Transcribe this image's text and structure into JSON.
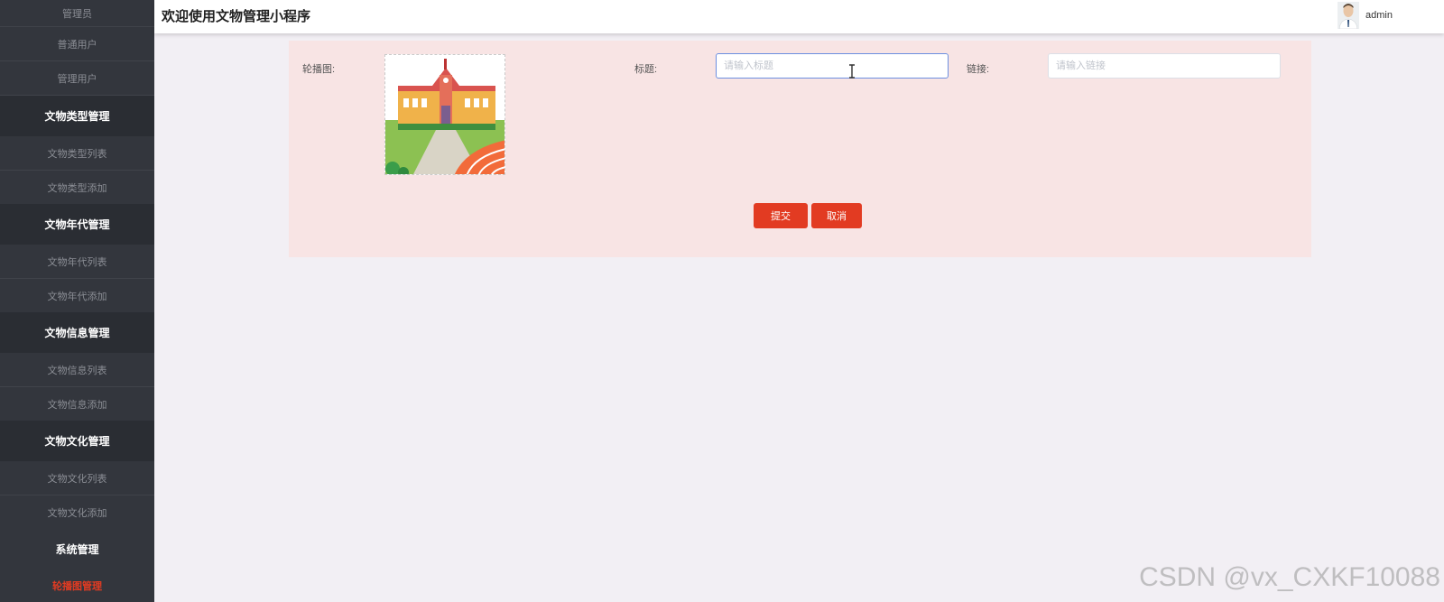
{
  "header": {
    "title": "欢迎使用文物管理小程序",
    "username": "admin"
  },
  "sidebar": {
    "items": [
      {
        "label": "管理员",
        "type": "item"
      },
      {
        "label": "普通用户",
        "type": "item"
      },
      {
        "label": "管理用户",
        "type": "item"
      },
      {
        "label": "文物类型管理",
        "type": "group"
      },
      {
        "label": "文物类型列表",
        "type": "item"
      },
      {
        "label": "文物类型添加",
        "type": "item"
      },
      {
        "label": "文物年代管理",
        "type": "group"
      },
      {
        "label": "文物年代列表",
        "type": "item"
      },
      {
        "label": "文物年代添加",
        "type": "item"
      },
      {
        "label": "文物信息管理",
        "type": "group"
      },
      {
        "label": "文物信息列表",
        "type": "item"
      },
      {
        "label": "文物信息添加",
        "type": "item"
      },
      {
        "label": "文物文化管理",
        "type": "group"
      },
      {
        "label": "文物文化列表",
        "type": "item"
      },
      {
        "label": "文物文化添加",
        "type": "item"
      },
      {
        "label": "系统管理",
        "type": "group"
      },
      {
        "label": "轮播图管理",
        "type": "item-active"
      }
    ]
  },
  "form": {
    "carousel_label": "轮播图:",
    "title_label": "标题:",
    "title_value": "",
    "title_placeholder": "请输入标题",
    "link_label": "链接:",
    "link_value": "",
    "link_placeholder": "请输入链接",
    "submit_label": "提交",
    "cancel_label": "取消"
  },
  "colors": {
    "accent": "#e23b22",
    "sidebar_bg": "#33363d",
    "card_bg": "#f8e4e4"
  },
  "watermark": "CSDN @vx_CXKF10088"
}
